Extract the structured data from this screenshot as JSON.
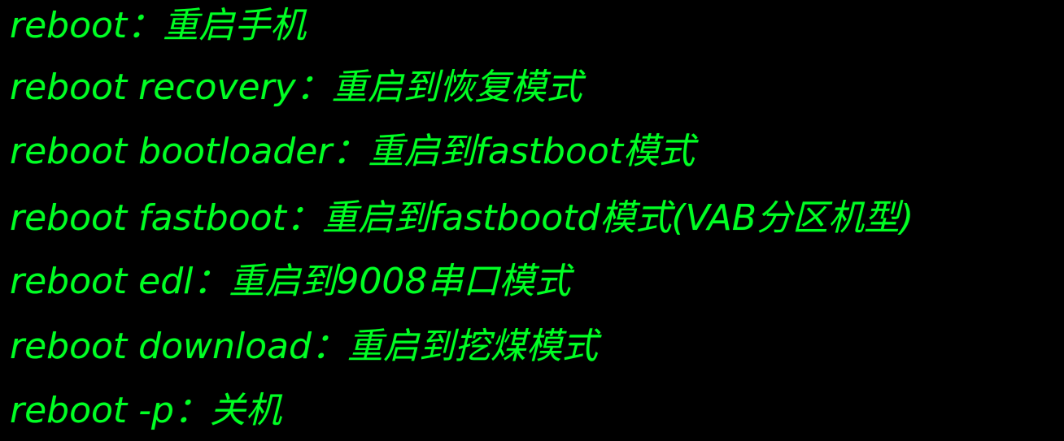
{
  "text_color": "#00ff24",
  "background_color": "#000000",
  "lines": [
    "reboot：重启手机",
    "reboot recovery：重启到恢复模式",
    "reboot bootloader：重启到fastboot模式",
    "reboot fastboot：重启到fastbootd模式(VAB分区机型)",
    "reboot edl：重启到9008串口模式",
    "reboot download：重启到挖煤模式",
    "reboot -p：关机"
  ]
}
